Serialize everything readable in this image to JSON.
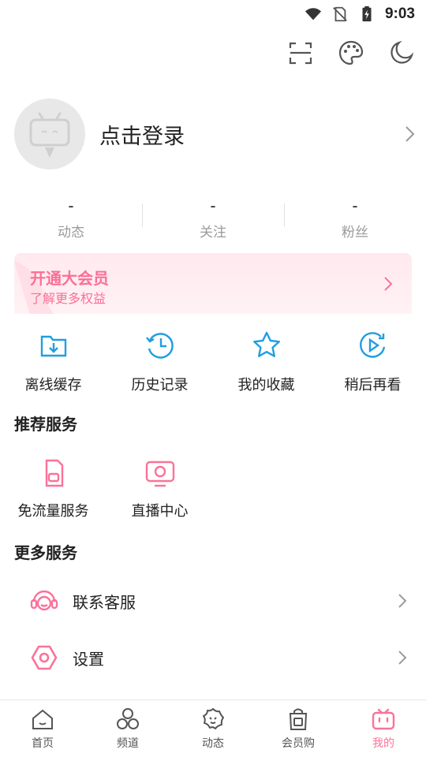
{
  "status_bar": {
    "time": "9:03",
    "icons": [
      "wifi-icon",
      "no-sim-icon",
      "battery-charging-icon"
    ]
  },
  "top_actions": [
    {
      "name": "scan-icon"
    },
    {
      "name": "theme-palette-icon"
    },
    {
      "name": "night-mode-icon"
    }
  ],
  "profile": {
    "login_text": "点击登录"
  },
  "stats": [
    {
      "value": "-",
      "label": "动态"
    },
    {
      "value": "-",
      "label": "关注"
    },
    {
      "value": "-",
      "label": "粉丝"
    }
  ],
  "vip": {
    "title": "开通大会员",
    "subtitle": "了解更多权益"
  },
  "quick_actions": [
    {
      "label": "离线缓存",
      "icon": "download-folder-icon"
    },
    {
      "label": "历史记录",
      "icon": "history-clock-icon"
    },
    {
      "label": "我的收藏",
      "icon": "star-icon"
    },
    {
      "label": "稍后再看",
      "icon": "watch-later-icon"
    }
  ],
  "recommended": {
    "title": "推荐服务",
    "items": [
      {
        "label": "免流量服务",
        "icon": "free-data-sim-icon"
      },
      {
        "label": "直播中心",
        "icon": "live-tv-icon"
      }
    ]
  },
  "more": {
    "title": "更多服务",
    "items": [
      {
        "label": "联系客服",
        "icon": "headset-icon"
      },
      {
        "label": "设置",
        "icon": "settings-hexagon-icon"
      }
    ]
  },
  "tabs": [
    {
      "label": "首页",
      "icon": "home-icon",
      "active": false
    },
    {
      "label": "频道",
      "icon": "channel-icon",
      "active": false
    },
    {
      "label": "动态",
      "icon": "dynamic-icon",
      "active": false
    },
    {
      "label": "会员购",
      "icon": "shopping-bag-icon",
      "active": false
    },
    {
      "label": "我的",
      "icon": "tv-mine-icon",
      "active": true
    }
  ],
  "colors": {
    "accent": "#fb7299",
    "blue": "#1f9fe0",
    "text": "#212121",
    "muted": "#9a9a9a"
  }
}
